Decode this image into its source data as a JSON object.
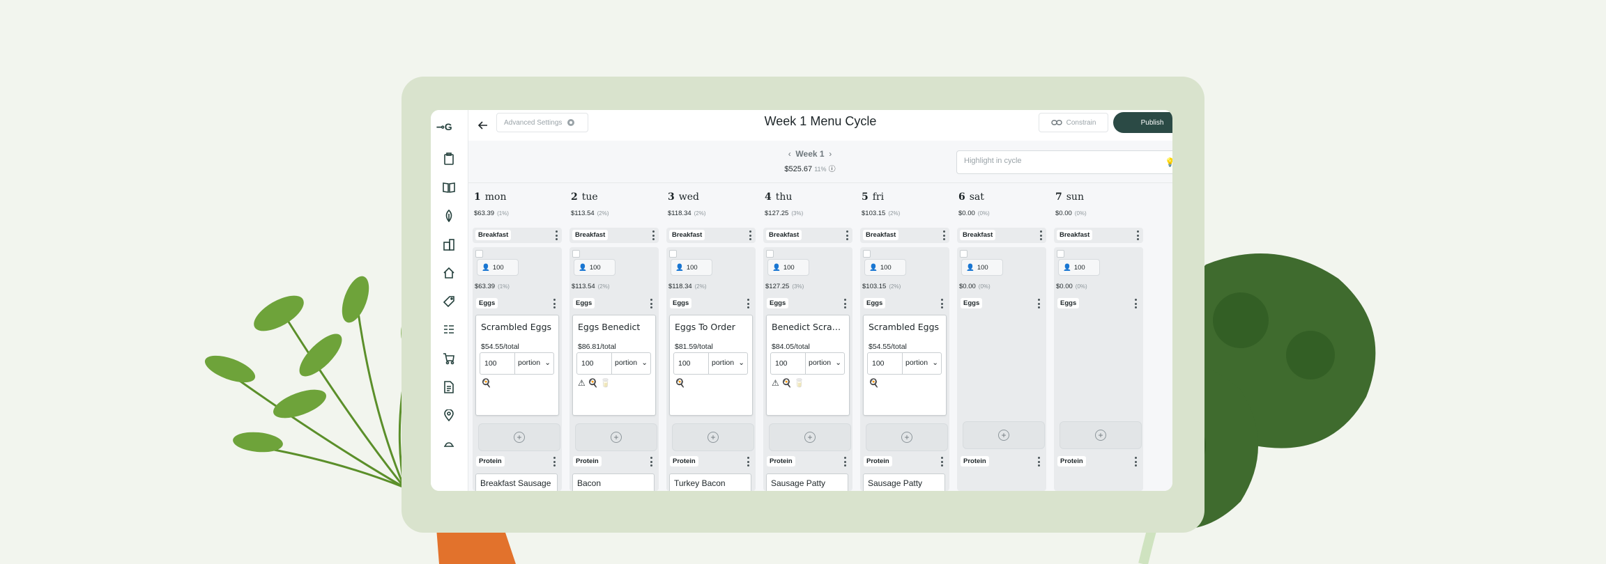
{
  "header": {
    "back_icon": "arrow-left-icon",
    "advanced_settings_label": "Advanced Settings",
    "title": "Week 1 Menu Cycle",
    "constrain_label": "Constrain",
    "publish_label": "Publish"
  },
  "week": {
    "label": "Week 1",
    "cost": "$525.67",
    "pct": "11%"
  },
  "highlight": {
    "placeholder": "Highlight in cycle"
  },
  "sidebar": {
    "items": [
      "clipboard-icon",
      "book-icon",
      "leaf-icon",
      "inventory-icon",
      "kitchen-icon",
      "tag-icon",
      "list-icon",
      "cart-icon",
      "document-icon",
      "location-icon",
      "dish-icon"
    ]
  },
  "days": [
    {
      "num": "1",
      "name": "mon",
      "cost": "$63.39",
      "pct": "(1%)",
      "meal": "Breakfast",
      "guests": "100",
      "meal_cost": "$63.39",
      "meal_pct": "(1%)",
      "category": "Eggs",
      "item": {
        "name": "Scrambled Eggs",
        "price": "$54.55/total",
        "qty": "100",
        "unit": "portion",
        "icons": "🍳"
      },
      "next_category": "Protein",
      "peek": "Breakfast Sausage"
    },
    {
      "num": "2",
      "name": "tue",
      "cost": "$113.54",
      "pct": "(2%)",
      "meal": "Breakfast",
      "guests": "100",
      "meal_cost": "$113.54",
      "meal_pct": "(2%)",
      "category": "Eggs",
      "item": {
        "name": "Eggs Benedict",
        "price": "$86.81/total",
        "qty": "100",
        "unit": "portion",
        "icons": "⚠ 🍳 🥛"
      },
      "next_category": "Protein",
      "peek": "Bacon"
    },
    {
      "num": "3",
      "name": "wed",
      "cost": "$118.34",
      "pct": "(2%)",
      "meal": "Breakfast",
      "guests": "100",
      "meal_cost": "$118.34",
      "meal_pct": "(2%)",
      "category": "Eggs",
      "item": {
        "name": "Eggs To Order",
        "price": "$81.59/total",
        "qty": "100",
        "unit": "portion",
        "icons": "🍳"
      },
      "next_category": "Protein",
      "peek": "Turkey Bacon"
    },
    {
      "num": "4",
      "name": "thu",
      "cost": "$127.25",
      "pct": "(3%)",
      "meal": "Breakfast",
      "guests": "100",
      "meal_cost": "$127.25",
      "meal_pct": "(3%)",
      "category": "Eggs",
      "item": {
        "name": "Benedict Scramble",
        "price": "$84.05/total",
        "qty": "100",
        "unit": "portion",
        "icons": "⚠ 🍳 🥛"
      },
      "next_category": "Protein",
      "peek": "Sausage Patty"
    },
    {
      "num": "5",
      "name": "fri",
      "cost": "$103.15",
      "pct": "(2%)",
      "meal": "Breakfast",
      "guests": "100",
      "meal_cost": "$103.15",
      "meal_pct": "(2%)",
      "category": "Eggs",
      "item": {
        "name": "Scrambled Eggs",
        "price": "$54.55/total",
        "qty": "100",
        "unit": "portion",
        "icons": "🍳"
      },
      "next_category": "Protein",
      "peek": "Sausage Patty"
    },
    {
      "num": "6",
      "name": "sat",
      "cost": "$0.00",
      "pct": "(0%)",
      "meal": "Breakfast",
      "guests": "100",
      "meal_cost": "$0.00",
      "meal_pct": "(0%)",
      "category": "Eggs",
      "next_category": "Protein"
    },
    {
      "num": "7",
      "name": "sun",
      "cost": "$0.00",
      "pct": "(0%)",
      "meal": "Breakfast",
      "guests": "100",
      "meal_cost": "$0.00",
      "meal_pct": "(0%)",
      "category": "Eggs",
      "next_category": "Protein"
    }
  ]
}
